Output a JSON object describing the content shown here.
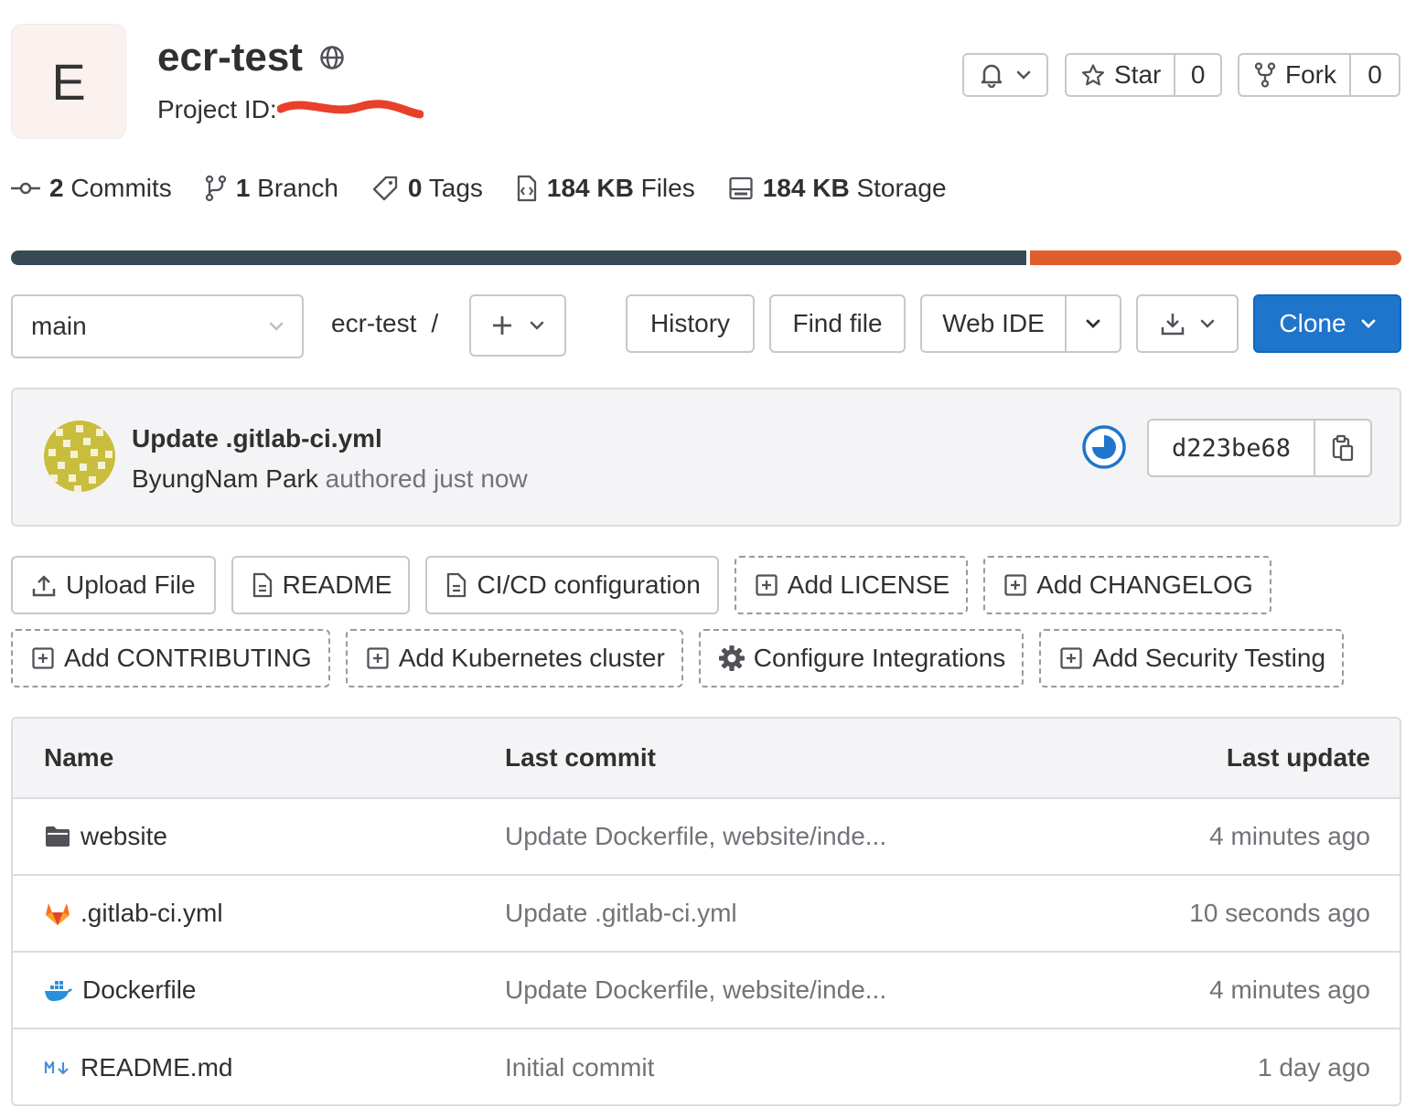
{
  "project": {
    "avatar_letter": "E",
    "name": "ecr-test",
    "id_label": "Project ID: "
  },
  "header_actions": {
    "star_label": "Star",
    "star_count": "0",
    "fork_label": "Fork",
    "fork_count": "0"
  },
  "stats": [
    {
      "value": "2",
      "label": " Commits",
      "icon": "commit-icon"
    },
    {
      "value": "1",
      "label": " Branch",
      "icon": "branch-icon"
    },
    {
      "value": "0",
      "label": " Tags",
      "icon": "tag-icon"
    },
    {
      "value": "184 KB",
      "label": " Files",
      "icon": "file-icon"
    },
    {
      "value": "184 KB",
      "label": " Storage",
      "icon": "storage-icon"
    }
  ],
  "languages": [
    {
      "color": "#384954",
      "fraction": 0.732
    },
    {
      "color": "#e05d2e",
      "fraction": 0.268
    }
  ],
  "toolbar": {
    "branch": "main",
    "breadcrumb_project": "ecr-test",
    "breadcrumb_sep": "/",
    "history": "History",
    "find_file": "Find file",
    "web_ide": "Web IDE",
    "clone": "Clone"
  },
  "last_commit": {
    "title": "Update .gitlab-ci.yml",
    "author": "ByungNam Park",
    "authored": " authored just now",
    "sha": "d223be68"
  },
  "quick_actions_row1": [
    {
      "label": "Upload File",
      "style": "solid",
      "icon": "upload-icon"
    },
    {
      "label": "README",
      "style": "solid",
      "icon": "doc-icon"
    },
    {
      "label": "CI/CD configuration",
      "style": "solid",
      "icon": "doc-icon"
    },
    {
      "label": "Add LICENSE",
      "style": "dashed",
      "icon": "plus-square-icon"
    },
    {
      "label": "Add CHANGELOG",
      "style": "dashed",
      "icon": "plus-square-icon"
    }
  ],
  "quick_actions_row2": [
    {
      "label": "Add CONTRIBUTING",
      "style": "dashed",
      "icon": "plus-square-icon"
    },
    {
      "label": "Add Kubernetes cluster",
      "style": "dashed",
      "icon": "plus-square-icon"
    },
    {
      "label": "Configure Integrations",
      "style": "dashed",
      "icon": "settings-icon"
    },
    {
      "label": "Add Security Testing",
      "style": "dashed",
      "icon": "plus-square-icon"
    }
  ],
  "table": {
    "headers": {
      "name": "Name",
      "last_commit": "Last commit",
      "last_update": "Last update"
    },
    "rows": [
      {
        "icon": "folder-icon",
        "name": "website",
        "commit": "Update Dockerfile, website/inde...",
        "updated": "4 minutes ago"
      },
      {
        "icon": "gitlab-icon",
        "name": ".gitlab-ci.yml",
        "commit": "Update .gitlab-ci.yml",
        "updated": "10 seconds ago"
      },
      {
        "icon": "docker-icon",
        "name": "Dockerfile",
        "commit": "Update Dockerfile, website/inde...",
        "updated": "4 minutes ago"
      },
      {
        "icon": "markdown-icon",
        "name": "README.md",
        "commit": "Initial commit",
        "updated": "1 day ago"
      }
    ]
  }
}
